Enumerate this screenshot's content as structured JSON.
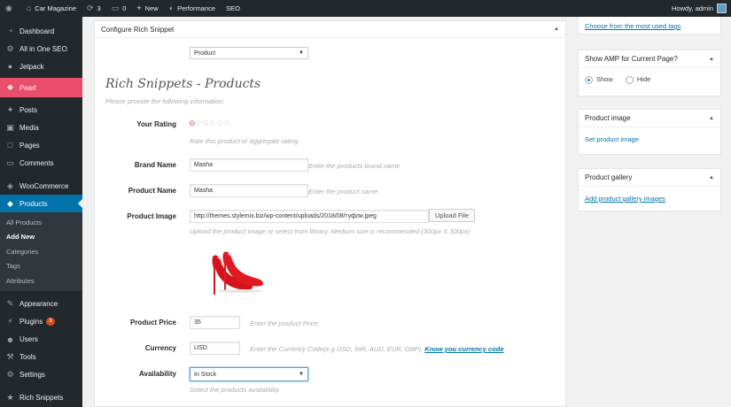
{
  "adminbar": {
    "site_name": "Car Magazine",
    "updates_count": "3",
    "comments_count": "0",
    "new_label": "New",
    "performance_label": "Performance",
    "seo_label": "SEO",
    "howdy": "Howdy, admin"
  },
  "sidebar": {
    "items": [
      {
        "label": "Dashboard",
        "icon": "dashboard-icon"
      },
      {
        "label": "All in One SEO",
        "icon": "seo-icon"
      },
      {
        "label": "Jetpack",
        "icon": "jetpack-icon"
      },
      {
        "label": "Pearl",
        "icon": "pearl-icon"
      },
      {
        "label": "Posts",
        "icon": "pin-icon"
      },
      {
        "label": "Media",
        "icon": "media-icon"
      },
      {
        "label": "Pages",
        "icon": "pages-icon"
      },
      {
        "label": "Comments",
        "icon": "comments-icon"
      },
      {
        "label": "WooCommerce",
        "icon": "woocommerce-icon"
      },
      {
        "label": "Products",
        "icon": "products-icon"
      },
      {
        "label": "Appearance",
        "icon": "brush-icon"
      },
      {
        "label": "Plugins",
        "icon": "plugins-icon",
        "badge": "3"
      },
      {
        "label": "Users",
        "icon": "users-icon"
      },
      {
        "label": "Tools",
        "icon": "tools-icon"
      },
      {
        "label": "Settings",
        "icon": "settings-icon"
      },
      {
        "label": "Rich Snippets",
        "icon": "rich-snippets-icon"
      }
    ],
    "products_sub": [
      "All Products",
      "Add New",
      "Categories",
      "Tags",
      "Attributes"
    ]
  },
  "panel": {
    "title": "Configure Rich Snippet",
    "type_select": "Product",
    "heading": "Rich Snippets - Products",
    "subheading": "Please provide the following information.",
    "rating_label": "Your Rating",
    "rating_hint": "Rate this product or aggregate rating.",
    "brand_label": "Brand Name",
    "brand_value": "Masha",
    "brand_hint": "Enter the products brand name",
    "name_label": "Product Name",
    "name_value": "Masha",
    "name_hint": "Enter the product name.",
    "image_label": "Product Image",
    "image_value": "http://themes.stylemix.biz/wp-content/uploads/2018/08/туфли.jpeg",
    "upload_button": "Upload File",
    "image_hint": "Upload the product image or select from library. Medium size is recommended (300px X 300px)",
    "price_label": "Product Price",
    "price_value": "35",
    "price_hint": "Enter the product Price.",
    "currency_label": "Currency",
    "currency_value": "USD",
    "currency_hint": "Enter the Currency Code(e.g USD, INR, AUD, EUR, GBP).",
    "currency_link": "Know you currency code",
    "availability_label": "Availability",
    "availability_value": "In Stock",
    "availability_hint": "Select the products availability."
  },
  "right": {
    "tags_link": "Choose from the most used tags",
    "amp_title": "Show AMP for Current Page?",
    "amp_show": "Show",
    "amp_hide": "Hide",
    "image_title": "Product image",
    "image_link": "Set product image",
    "gallery_title": "Product gallery",
    "gallery_link": "Add product gallery images"
  },
  "colors": {
    "admin_dark": "#23282d",
    "pearl_pink": "#e94f6a",
    "wp_blue": "#0073aa"
  }
}
